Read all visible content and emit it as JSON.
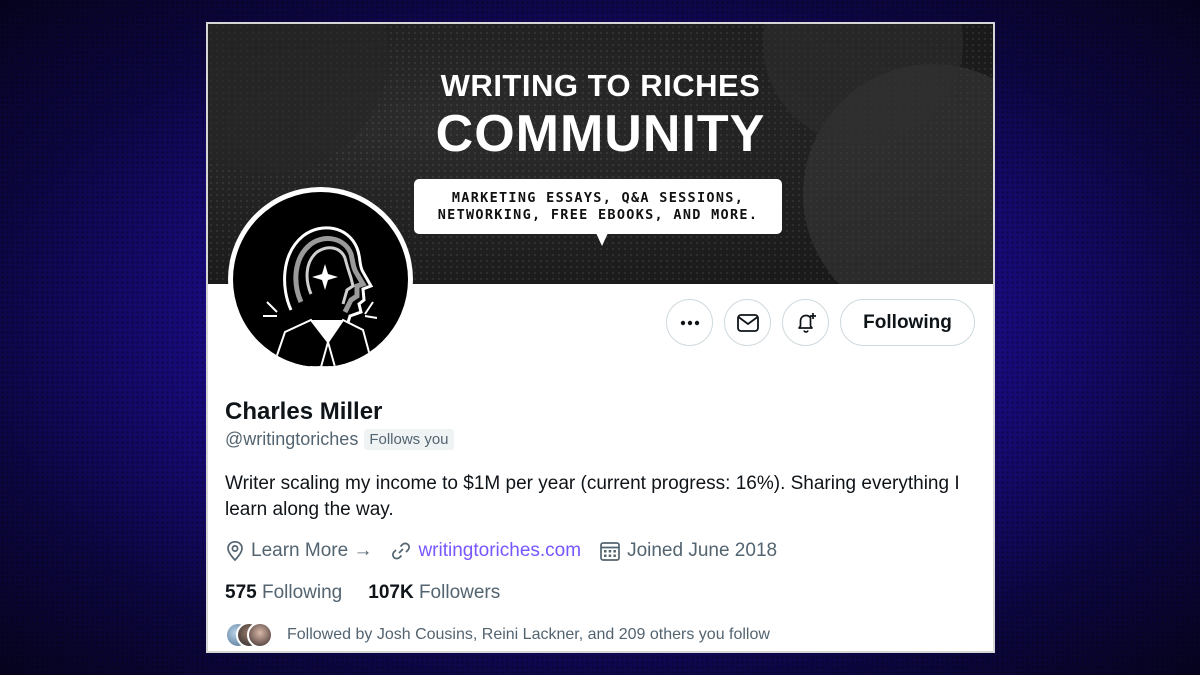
{
  "banner": {
    "line1": "WRITING TO RICHES",
    "line2": "COMMUNITY",
    "bubble_line1": "MARKETING ESSAYS, Q&A SESSIONS,",
    "bubble_line2": "NETWORKING, FREE EBOOKS, AND MORE."
  },
  "actions": {
    "more_icon": "more-horizontal-icon",
    "message_icon": "envelope-icon",
    "notify_icon": "bell-plus-icon",
    "follow_label": "Following"
  },
  "profile": {
    "name": "Charles Miller",
    "handle": "@writingtoriches",
    "follows_you": "Follows you",
    "bio": "Writer scaling my income to $1M per year (current progress: 16%). Sharing everything I learn along the way.",
    "location": "Learn More →",
    "website": "writingtoriches.com",
    "joined": "Joined June 2018",
    "following_count": "575",
    "following_label": "Following",
    "followers_count": "107K",
    "followers_label": "Followers",
    "followed_by": "Followed by Josh Cousins, Reini Lackner, and 209 others you follow"
  },
  "colors": {
    "link": "#7856ff",
    "secondary_text": "#536471",
    "primary_text": "#0f1419",
    "background_purple": "#2a14b8"
  }
}
